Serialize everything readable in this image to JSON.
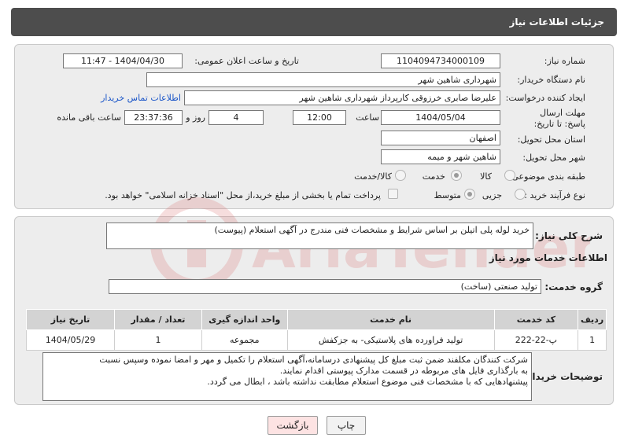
{
  "header": {
    "title": "جزئیات اطلاعات نیاز"
  },
  "labels": {
    "need_number": "شماره نیاز:",
    "announce_datetime": "تاریخ و ساعت اعلان عمومی:",
    "buyer_org": "نام دستگاه خریدار:",
    "requester": "ایجاد کننده درخواست:",
    "contact_link": "اطلاعات تماس خریدار",
    "deadline": "مهلت ارسال پاسخ: تا تاریخ:",
    "hour": "ساعت",
    "day_and": "روز و",
    "remaining": "ساعت باقی مانده",
    "province": "استان محل تحویل:",
    "city": "شهر محل تحویل:",
    "category": "طبقه بندی موضوعی:",
    "purchase_type": "نوع فرآیند خرید :",
    "description": "شرح کلی نیاز:",
    "services_info": "اطلاعات خدمات مورد نیاز",
    "service_group": "گروه خدمت:",
    "buyer_notes": "توضیحات خریدار:"
  },
  "values": {
    "need_number": "1104094734000109",
    "announce_datetime": "1404/04/30 - 11:47",
    "buyer_org": "شهرداری شاهین شهر",
    "requester": "علیرضا صابری خرزوقی کارپرداز شهرداری شاهین شهر",
    "deadline_date": "1404/05/04",
    "deadline_time": "12:00",
    "days": "4",
    "remaining_time": "23:37:36",
    "province": "اصفهان",
    "city": "شاهین شهر و میمه",
    "description": "خرید لوله پلی اتیلن بر اساس شرایط و مشخصات فنی مندرج در آگهی استعلام (پیوست)",
    "service_group": "تولید صنعتی (ساخت)"
  },
  "category_options": [
    {
      "label": "کالا",
      "selected": false
    },
    {
      "label": "خدمت",
      "selected": true
    },
    {
      "label": "کالا/خدمت",
      "selected": false
    }
  ],
  "purchase_options": [
    {
      "label": "جزیی",
      "selected": false
    },
    {
      "label": "متوسط",
      "selected": true
    }
  ],
  "payment_note": "پرداخت تمام یا بخشی از مبلغ خرید،از محل \"اسناد خزانه اسلامی\" خواهد بود.",
  "table": {
    "headers": [
      "ردیف",
      "کد خدمت",
      "نام خدمت",
      "واحد اندازه گیری",
      "تعداد / مقدار",
      "تاریخ نیاز"
    ],
    "rows": [
      [
        "1",
        "پ-22-222",
        "تولید فراورده های پلاستیکی- به جزکفش",
        "مجموعه",
        "1",
        "1404/05/29"
      ]
    ]
  },
  "notes": {
    "line1": "شرکت کنندگان مکلفند ضمن ثبت مبلغ کل پیشنهادی درسامانه،آگهی استعلام را  تکمیل و مهر و امضا نموده وسپس نسبت",
    "line2": "به بارگذاری فایل های مربوطه در قسمت مدارک پیوستی اقدام نمایند.",
    "line3": "پیشنهادهایی که با مشخصات فنی موضوع استعلام مطابقت نداشته باشد ، ابطال می گردد."
  },
  "buttons": {
    "print": "چاپ",
    "back": "بازگشت"
  },
  "watermark": {
    "text": "AriaTender.net"
  },
  "colors": {
    "header_bg": "#4d4d4d",
    "link": "#1a55c8",
    "back_button_bg": "#fde3e3",
    "watermark": "#d96a6a"
  }
}
